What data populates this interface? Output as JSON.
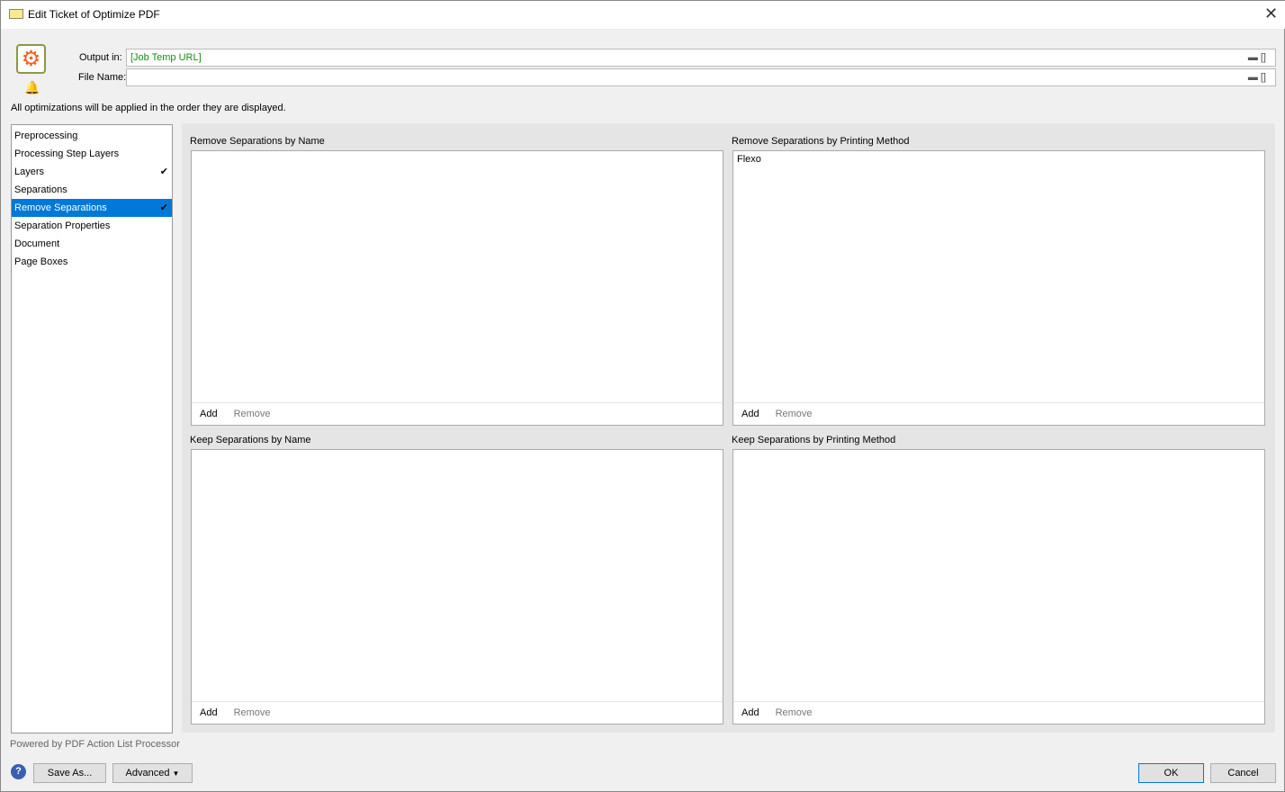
{
  "window": {
    "title": "Edit Ticket of Optimize PDF"
  },
  "header": {
    "output_label": "Output in:",
    "output_value": "[Job Temp URL]",
    "filename_label": "File Name:",
    "filename_value": "",
    "note": "All optimizations will be applied in the order they are displayed."
  },
  "sidebar": {
    "items": [
      {
        "label": "Preprocessing",
        "checked": false
      },
      {
        "label": "Processing Step Layers",
        "checked": false
      },
      {
        "label": "Layers",
        "checked": true
      },
      {
        "label": "Separations",
        "checked": false
      },
      {
        "label": "Remove Separations",
        "checked": true,
        "selected": true
      },
      {
        "label": "Separation Properties",
        "checked": false
      },
      {
        "label": "Document",
        "checked": false
      },
      {
        "label": "Page Boxes",
        "checked": false
      }
    ]
  },
  "panels": [
    {
      "title": "Remove Separations by Name",
      "items": [],
      "add": "Add",
      "remove": "Remove"
    },
    {
      "title": "Remove Separations by Printing Method",
      "items": [
        "Flexo"
      ],
      "add": "Add",
      "remove": "Remove"
    },
    {
      "title": "Keep Separations by Name",
      "items": [],
      "add": "Add",
      "remove": "Remove"
    },
    {
      "title": "Keep Separations by Printing Method",
      "items": [],
      "add": "Add",
      "remove": "Remove"
    }
  ],
  "footer": {
    "powered": "Powered by PDF Action List Processor",
    "save_as": "Save As...",
    "advanced": "Advanced",
    "ok": "OK",
    "cancel": "Cancel"
  },
  "colors": {
    "selection": "#0078d7",
    "path_text": "#1a8a1a",
    "logo": "#f06020"
  }
}
